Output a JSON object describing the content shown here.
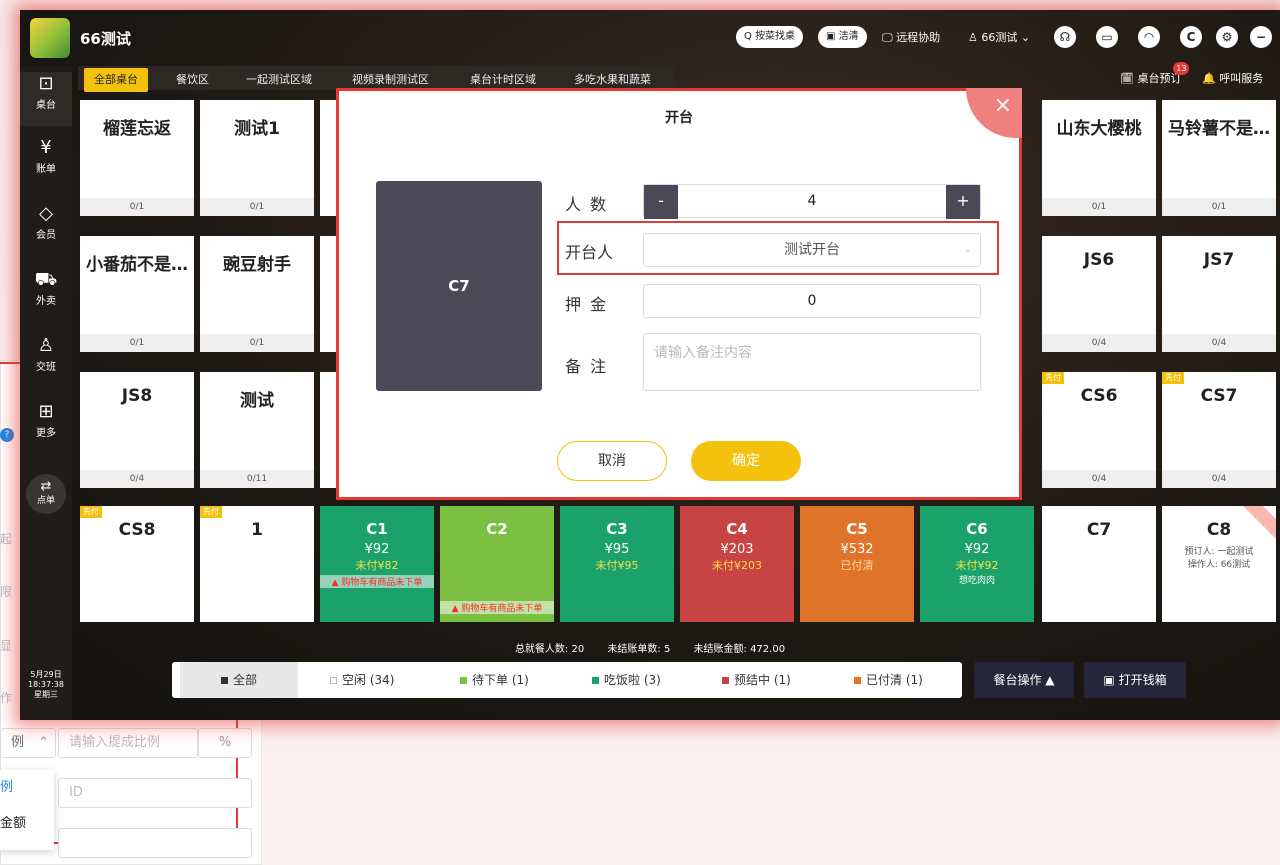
{
  "background": {
    "ratio_label": "例",
    "ratio_placeholder": "请输入提成比例",
    "percent": "%",
    "id_placeholder": "ID",
    "dropdown_items": [
      "例",
      "金额"
    ],
    "side_fragments": [
      "起",
      "限",
      "显",
      "作"
    ]
  },
  "app": {
    "shop_name": "66测试",
    "top_actions": {
      "search": "按菜找桌",
      "clean": "洁清",
      "remote": "远程协助",
      "user": "66测试"
    },
    "sidebar": [
      {
        "icon": "table-icon",
        "label": "桌台"
      },
      {
        "icon": "bill-icon",
        "label": "账单"
      },
      {
        "icon": "member-icon",
        "label": "会员"
      },
      {
        "icon": "takeout-icon",
        "label": "外卖"
      },
      {
        "icon": "shift-icon",
        "label": "交班"
      },
      {
        "icon": "more-icon",
        "label": "更多"
      }
    ],
    "order_button": "点单",
    "datetime": {
      "date": "5月29日",
      "time": "18:37:38",
      "weekday": "星期三"
    },
    "tabs": [
      "全部桌台",
      "餐饮区",
      "一起测试区域",
      "视频录制测试区",
      "桌台计时区域",
      "多吃水果和蔬菜"
    ],
    "right_buttons": {
      "reserve": "桌台预订",
      "reserve_badge": "13",
      "call": "呼叫服务"
    },
    "cards": [
      {
        "name": "榴莲忘返",
        "count": "0/1"
      },
      {
        "name": "测试1",
        "count": "0/1"
      },
      {
        "name": "山东大樱桃",
        "count": "0/1"
      },
      {
        "name": "马铃薯不是…",
        "count": "0/1"
      },
      {
        "name": "小番茄不是…",
        "count": "0/1"
      },
      {
        "name": "豌豆射手",
        "count": "0/1"
      },
      {
        "name": "JS6",
        "count": "0/4"
      },
      {
        "name": "JS7",
        "count": "0/4"
      },
      {
        "name": "JS8",
        "count": "0/4"
      },
      {
        "name": "测试",
        "count": "0/11"
      },
      {
        "name": "CS6",
        "count": "0/4",
        "tag": "先付"
      },
      {
        "name": "CS7",
        "count": "0/4",
        "tag": "先付"
      },
      {
        "name": "CS8",
        "tag": "先付"
      },
      {
        "name": "1",
        "tag": "先付"
      },
      {
        "name": "C7"
      },
      {
        "name": "C8",
        "reserved_by": "预订人: 一起测试",
        "operator": "操作人: 66测试"
      }
    ],
    "colored_cards": [
      {
        "name": "C1",
        "amount": "¥92",
        "unpaid": "未付¥82",
        "warning": "购物车有商品未下单",
        "color": "#1aa26a"
      },
      {
        "name": "C2",
        "amount": "",
        "unpaid": "",
        "warning": "购物车有商品未下单",
        "color": "#7bc043"
      },
      {
        "name": "C3",
        "amount": "¥95",
        "unpaid": "未付¥95",
        "warning": "",
        "color": "#1aa26a"
      },
      {
        "name": "C4",
        "amount": "¥203",
        "unpaid": "未付¥203",
        "warning": "",
        "color": "#c84444"
      },
      {
        "name": "C5",
        "amount": "¥532",
        "unpaid": "已付清",
        "warning": "",
        "color": "#e0732a"
      },
      {
        "name": "C6",
        "amount": "¥92",
        "unpaid": "未付¥92",
        "note": "想吃肉肉",
        "warning": "",
        "color": "#1aa26a"
      }
    ],
    "summary": {
      "guests": "总就餐人数: 20",
      "bills": "未结账单数: 5",
      "amount": "未结账金额: 472.00"
    },
    "filters": [
      {
        "label": "全部",
        "color": "#333"
      },
      {
        "label": "空闲 (34)",
        "color": "#ffffff"
      },
      {
        "label": "待下单 (1)",
        "color": "#7bc043"
      },
      {
        "label": "吃饭啦 (3)",
        "color": "#1aa26a"
      },
      {
        "label": "预结中 (1)",
        "color": "#c84444"
      },
      {
        "label": "已付清 (1)",
        "color": "#e0732a"
      }
    ],
    "ops": {
      "table_ops": "餐台操作 ▲",
      "cash": "打开钱箱"
    }
  },
  "dialog": {
    "title": "开台",
    "table": "C7",
    "fields": {
      "people_label": "人 数",
      "people_value": "4",
      "opener_label": "开台人",
      "opener_value": "测试开台",
      "deposit_label": "押 金",
      "deposit_value": "0",
      "note_label": "备 注",
      "note_placeholder": "请输入备注内容"
    },
    "cancel": "取消",
    "confirm": "确定"
  }
}
